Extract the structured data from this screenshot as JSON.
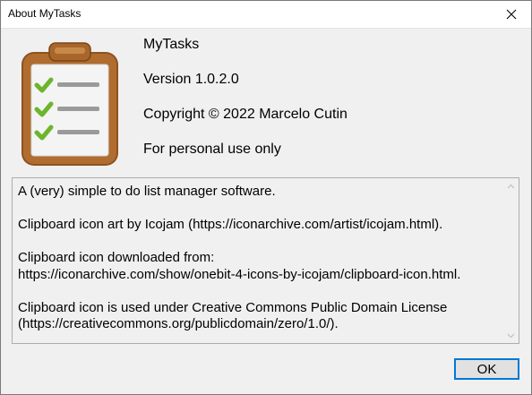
{
  "window": {
    "title": "About MyTasks"
  },
  "app": {
    "name": "MyTasks",
    "version": "Version 1.0.2.0",
    "copyright": "Copyright ©  2022 Marcelo Cutin",
    "license_note": "For personal use only",
    "icon": "clipboard-checklist-icon"
  },
  "description": {
    "paragraphs": [
      "A (very) simple to do list manager software.",
      "Clipboard icon art by Icojam (https://iconarchive.com/artist/icojam.html).",
      "Clipboard icon downloaded from:\nhttps://iconarchive.com/show/onebit-4-icons-by-icojam/clipboard-icon.html.",
      "Clipboard icon is used under Creative Commons Public Domain License\n(https://creativecommons.org/publicdomain/zero/1.0/)."
    ]
  },
  "buttons": {
    "ok_label": "OK"
  },
  "colors": {
    "accent": "#0078d7",
    "clipboard_brown": "#a8652a",
    "check_green": "#6cb52d"
  }
}
